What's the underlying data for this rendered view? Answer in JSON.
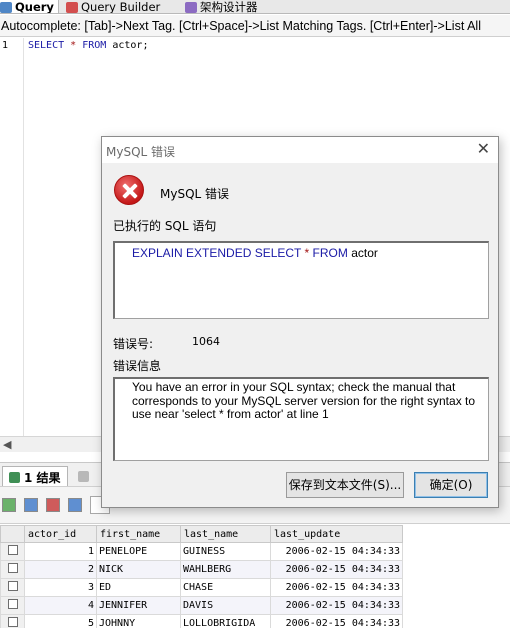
{
  "tabs": [
    {
      "label": "Query",
      "icon": "query-icon",
      "active": true
    },
    {
      "label": "Query Builder",
      "icon": "query-builder-icon",
      "active": false
    },
    {
      "label": "架构设计器",
      "icon": "schema-designer-icon",
      "active": false
    }
  ],
  "autocomplete_hint": "Autocomplete: [Tab]->Next Tag. [Ctrl+Space]->List Matching Tags. [Ctrl+Enter]->List All",
  "editor": {
    "line_number": "1",
    "sql": {
      "kw1": "SELECT",
      "star": "*",
      "kw2": "FROM",
      "table": "actor;"
    }
  },
  "results": {
    "tabs": [
      {
        "label": "1 结果",
        "icon": "results-grid-icon"
      }
    ],
    "columns": [
      "actor_id",
      "first_name",
      "last_name",
      "last_update"
    ],
    "rows": [
      [
        "1",
        "PENELOPE",
        "GUINESS",
        "2006-02-15 04:34:33"
      ],
      [
        "2",
        "NICK",
        "WAHLBERG",
        "2006-02-15 04:34:33"
      ],
      [
        "3",
        "ED",
        "CHASE",
        "2006-02-15 04:34:33"
      ],
      [
        "4",
        "JENNIFER",
        "DAVIS",
        "2006-02-15 04:34:33"
      ],
      [
        "5",
        "JOHNNY",
        "LOLLOBRIGIDA",
        "2006-02-15 04:34:33"
      ]
    ]
  },
  "dialog": {
    "title": "MySQL 错误",
    "close": "✕",
    "heading": "MySQL 错误",
    "executed_sql_label": "已执行的 SQL 语句",
    "executed_sql": {
      "kw1": "EXPLAIN EXTENDED SELECT",
      "star": "*",
      "kw2": "FROM",
      "table": "actor"
    },
    "error_number_label": "错误号:",
    "error_number": "1064",
    "error_info_label": "错误信息",
    "error_message": "You have an error in your SQL syntax; check the manual that corresponds to your MySQL server version for the right syntax to use near 'select * from actor' at line 1",
    "save_button": "保存到文本文件(S)...",
    "ok_button": "确定(O)"
  },
  "colors": {
    "error_red": "#c41818",
    "sql_keyword": "#1a1aa6",
    "ok_border": "#3c7fb1"
  }
}
